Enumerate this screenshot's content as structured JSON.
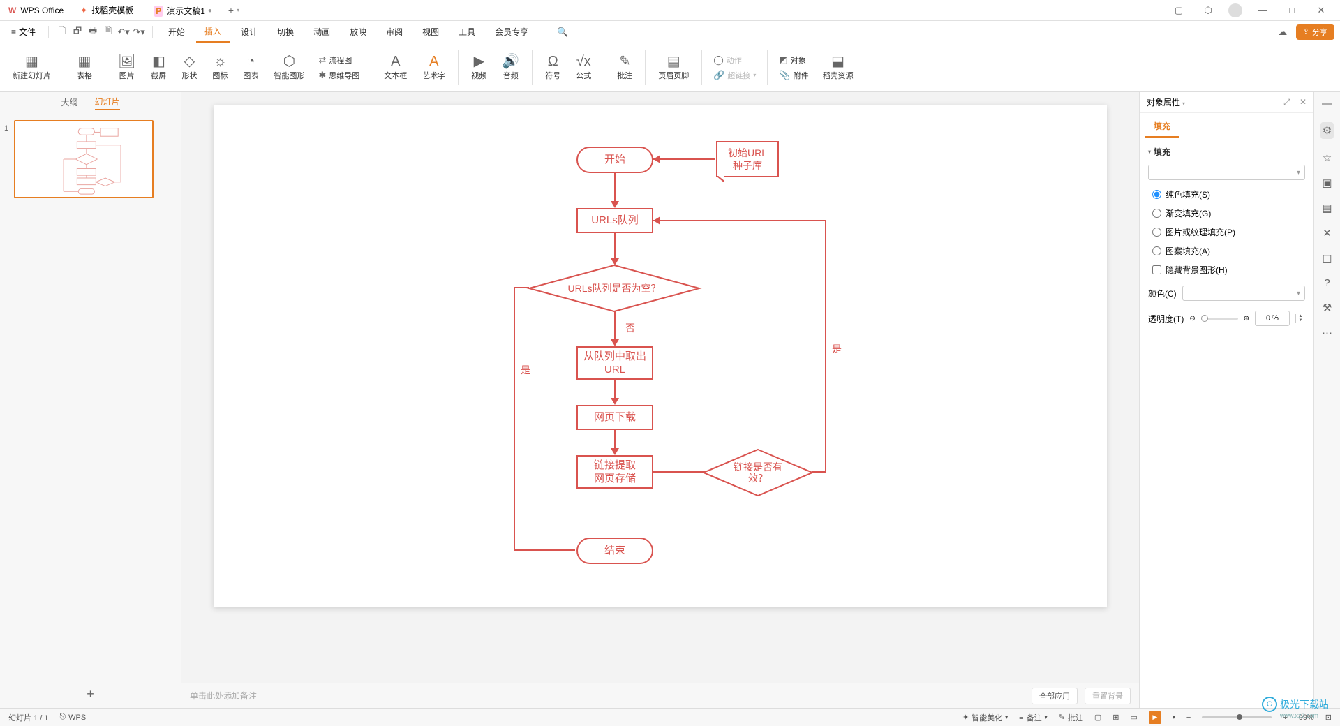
{
  "titlebar": {
    "wps_label": "WPS Office",
    "find_label": "找稻壳模板",
    "doc_title": "演示文稿1",
    "modified_dot": "●",
    "add": "+",
    "dd": "▾"
  },
  "menubar": {
    "file": "文件",
    "items": [
      "开始",
      "插入",
      "设计",
      "切换",
      "动画",
      "放映",
      "审阅",
      "视图",
      "工具",
      "会员专享"
    ],
    "active_index": 1,
    "share": "分享"
  },
  "ribbon": {
    "groups": [
      {
        "icon": "▦",
        "label": "新建幻灯片",
        "dd": true
      },
      {
        "icon": "▦",
        "label": "表格",
        "dd": true
      },
      {
        "icon": "🖼",
        "label": "图片",
        "dd": true
      },
      {
        "icon": "◧",
        "label": "截屏",
        "dd": true
      },
      {
        "icon": "◇",
        "label": "形状",
        "dd": true
      },
      {
        "icon": "☼",
        "label": "图标"
      },
      {
        "icon": "◔",
        "label": "图表"
      },
      {
        "icon": "⬡",
        "label": "智能图形"
      }
    ],
    "flowchart_top": "流程图",
    "mindmap_bottom": "思维导图",
    "textbox": "文本框",
    "wordart": "艺术字",
    "video": "视频",
    "audio": "音频",
    "symbol": "符号",
    "formula": "公式",
    "comment": "批注",
    "headerfooter": "页眉页脚",
    "action": "动作",
    "hyperlink": "超链接",
    "objectgroup": "对象",
    "attachment": "附件",
    "docresources": "稻壳资源"
  },
  "leftpanel": {
    "tab_outline": "大纲",
    "tab_slides": "幻灯片",
    "slide_no": "1"
  },
  "flowchart": {
    "start": "开始",
    "seed": "初始URL\n种子库",
    "queue": "URLs队列",
    "decision_empty": "URLs队列是否为空？",
    "no": "否",
    "yes": "是",
    "dequeue": "从队列中取出\nURL",
    "download": "网页下载",
    "extract": "链接提取\n网页存储",
    "valid": "链接是否有\n效？",
    "end": "结束"
  },
  "rightpanel": {
    "title": "对象属性",
    "tab_fill": "填充",
    "section_fill": "填充",
    "fill_options": {
      "solid": "纯色填充(S)",
      "gradient": "渐变填充(G)",
      "picture": "图片或纹理填充(P)",
      "pattern": "图案填充(A)",
      "hidebg": "隐藏背景图形(H)"
    },
    "color_label": "颜色(C)",
    "transparency_label": "透明度(T)",
    "transparency_value": "0",
    "percent": "%"
  },
  "notes": {
    "placeholder": "单击此处添加备注",
    "apply_all": "全部应用",
    "reset_bg": "重置背景"
  },
  "statusbar": {
    "slide_info": "幻灯片 1 / 1",
    "wps_label": "WPS",
    "beautify": "智能美化",
    "notes": "备注",
    "comments": "批注",
    "zoom_pct": "99%"
  },
  "watermark": {
    "name": "极光下载站",
    "url": "www.xz7.com"
  }
}
